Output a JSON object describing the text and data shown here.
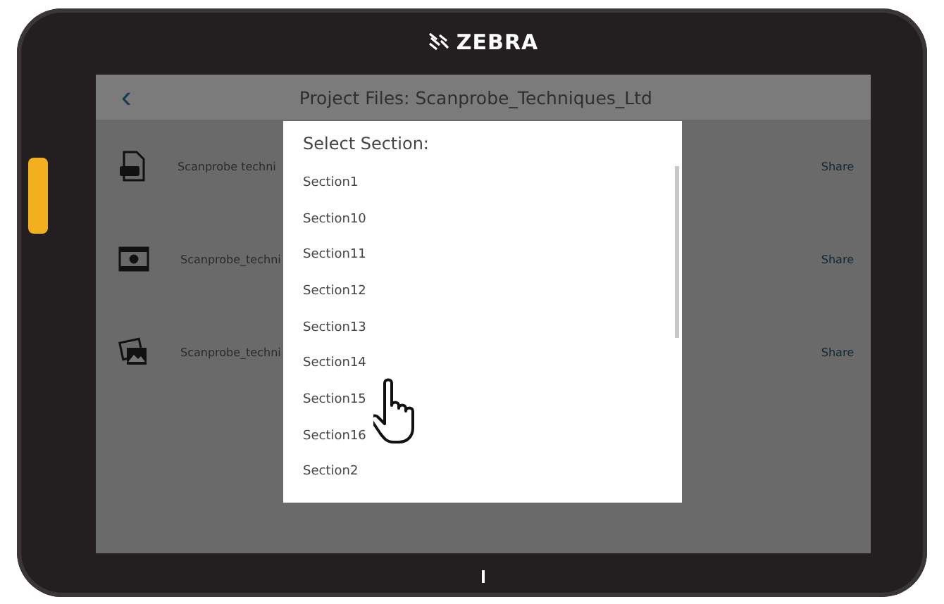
{
  "device": {
    "brand": "ZEBRA"
  },
  "header": {
    "back": "‹",
    "title": "Project Files: Scanprobe_Techniques_Ltd"
  },
  "files": [
    {
      "kind": "pdf",
      "name": "Scanprobe techni",
      "action": "Share"
    },
    {
      "kind": "video",
      "name": "Scanprobe_techni",
      "action": "Share"
    },
    {
      "kind": "image",
      "name": "Scanprobe_techni",
      "action": "Share"
    }
  ],
  "dialog": {
    "title": "Select Section:",
    "items": [
      "Section1",
      "Section10",
      "Section11",
      "Section12",
      "Section13",
      "Section14",
      "Section15",
      "Section16",
      "Section2"
    ]
  }
}
